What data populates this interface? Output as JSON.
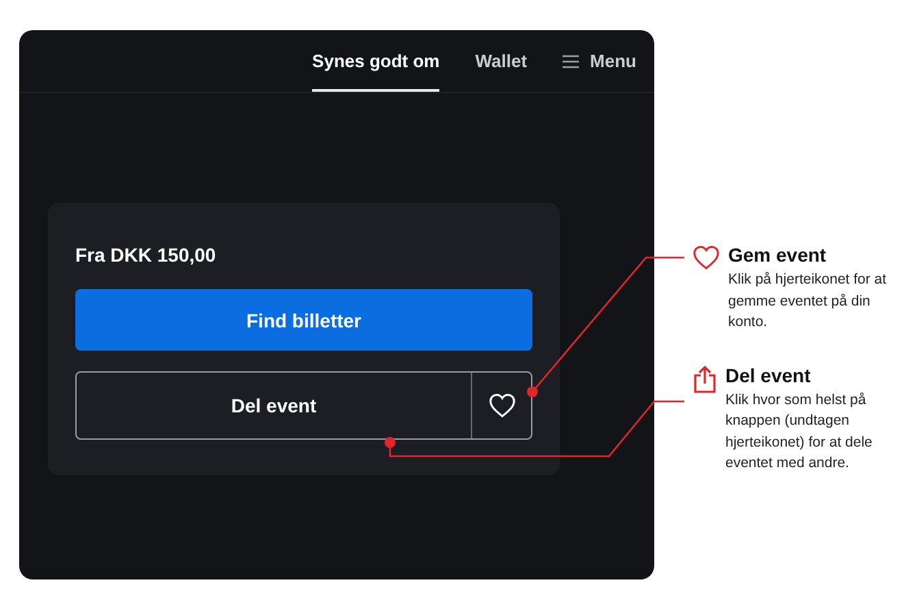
{
  "nav": {
    "items": [
      {
        "kind": "tab",
        "label": "Synes godt om",
        "selected": true
      },
      {
        "kind": "tab",
        "label": "Wallet",
        "selected": false
      },
      {
        "kind": "menu",
        "label": "Menu",
        "selected": false
      }
    ]
  },
  "card": {
    "price": "Fra DKK 150,00",
    "primary_button": "Find billetter",
    "share_button": "Del event"
  },
  "annotations": [
    {
      "kind": "heart",
      "title": "Gem event",
      "text": "Klik på hjerteikonet for at gemme eventet på din konto."
    },
    {
      "kind": "share",
      "title": "Del event",
      "text": "Klik hvor som helst på knappen (undtagen hjerteikonet) for at dele eventet med andre."
    }
  ]
}
